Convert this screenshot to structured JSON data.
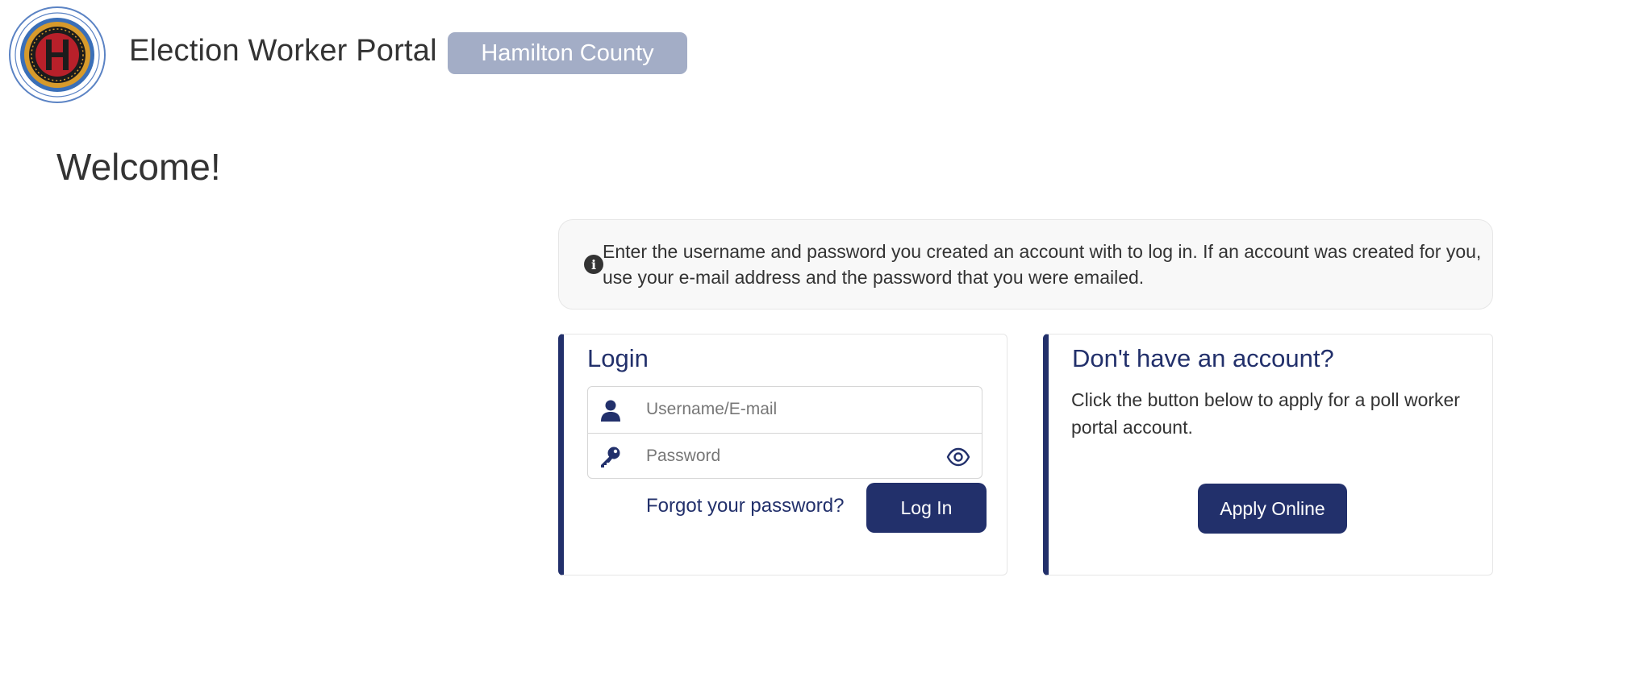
{
  "header": {
    "app_title": "Election Worker Portal",
    "county_badge": "Hamilton County"
  },
  "main": {
    "welcome_heading": "Welcome!",
    "info_text": "Enter the username and password you created an account with to log in. If an account was created for you, use your e-mail address and the password that you were emailed."
  },
  "login": {
    "title": "Login",
    "username_placeholder": "Username/E-mail",
    "username_value": "",
    "password_placeholder": "Password",
    "password_value": "",
    "forgot_label": "Forgot your password?",
    "login_button_label": "Log In"
  },
  "apply": {
    "title": "Don't have an account?",
    "text": "Click the button below to apply for a poll worker portal account.",
    "apply_button_label": "Apply Online"
  },
  "icons": {
    "seal": "county-seal-icon",
    "info": "info-icon",
    "user": "user-icon",
    "key": "key-icon",
    "eye": "eye-icon"
  },
  "colors": {
    "brand": "#22306b",
    "badge": "#a3adc6",
    "info_background": "#f8f8f8"
  }
}
